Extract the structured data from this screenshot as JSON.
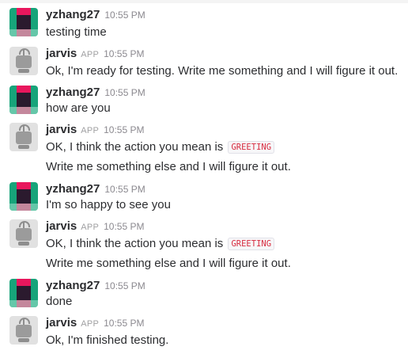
{
  "messages": [
    {
      "author": "yzhang27",
      "time": "10:55 PM",
      "lines": [
        "testing time"
      ]
    },
    {
      "author": "jarvis",
      "app_badge": "APP",
      "time": "10:55 PM",
      "lines": [
        "Ok, I'm ready for testing. Write me something and I will figure it out."
      ]
    },
    {
      "author": "yzhang27",
      "time": "10:55 PM",
      "lines": [
        "how are you"
      ]
    },
    {
      "author": "jarvis",
      "app_badge": "APP",
      "time": "10:55 PM",
      "line_prefix": "OK, I think the action you mean is",
      "action_code": "GREETING",
      "lines": [
        "Write me something else and I will figure it out."
      ]
    },
    {
      "author": "yzhang27",
      "time": "10:55 PM",
      "lines": [
        "I'm so happy to see you"
      ]
    },
    {
      "author": "jarvis",
      "app_badge": "APP",
      "time": "10:55 PM",
      "line_prefix": "OK, I think the action you mean is",
      "action_code": "GREETING",
      "lines": [
        "Write me something else and I will figure it out."
      ]
    },
    {
      "author": "yzhang27",
      "time": "10:55 PM",
      "lines": [
        "done"
      ]
    },
    {
      "author": "jarvis",
      "app_badge": "APP",
      "time": "10:55 PM",
      "lines": [
        "Ok, I'm finished testing."
      ]
    }
  ]
}
